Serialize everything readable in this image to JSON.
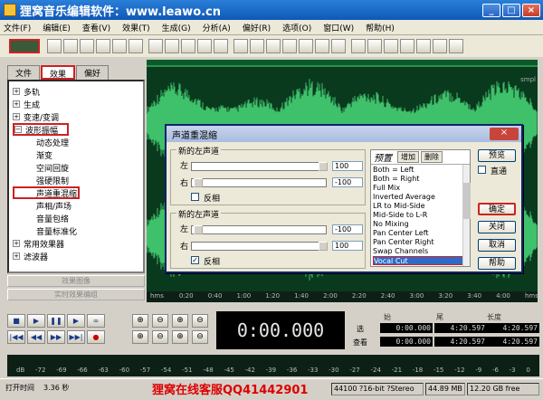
{
  "window": {
    "title": "狸窝音乐编辑软件：www.leawo.cn",
    "buttons": [
      "_",
      "□",
      "×"
    ]
  },
  "menu": [
    "文件(F)",
    "编辑(E)",
    "查看(V)",
    "效果(T)",
    "生成(G)",
    "分析(A)",
    "偏好(R)",
    "选项(O)",
    "窗口(W)",
    "帮助(H)"
  ],
  "toolbar": {
    "icon_count": 25
  },
  "left_panel": {
    "tabs": [
      "文件",
      "效果",
      "偏好"
    ],
    "tree": [
      {
        "label": "多轨",
        "type": "group",
        "expanded": false
      },
      {
        "label": "生成",
        "type": "group",
        "expanded": false
      },
      {
        "label": "变速/变调",
        "type": "group",
        "expanded": false
      },
      {
        "label": "波形振幅",
        "type": "group",
        "expanded": true,
        "highlight": true
      },
      {
        "label": "动态处理",
        "type": "child"
      },
      {
        "label": "渐变",
        "type": "child"
      },
      {
        "label": "空间回旋",
        "type": "child"
      },
      {
        "label": "强硬限制",
        "type": "child"
      },
      {
        "label": "声道重混缩",
        "type": "child",
        "selected": true
      },
      {
        "label": "声相/声场",
        "type": "child"
      },
      {
        "label": "音量包络",
        "type": "child"
      },
      {
        "label": "音量标准化",
        "type": "child"
      },
      {
        "label": "常用效果器",
        "type": "group",
        "expanded": false
      },
      {
        "label": "滤波器",
        "type": "group",
        "expanded": false
      }
    ],
    "buttons": [
      "效果图像",
      "实时效果编组"
    ]
  },
  "wave": {
    "unit_top": "smpl",
    "unit_bottom": "smpl",
    "color": "#3fc06a",
    "bg": "#0a3a1e"
  },
  "timeline": [
    "hms",
    "0:20",
    "0:40",
    "1:00",
    "1:20",
    "1:40",
    "2:00",
    "2:20",
    "2:40",
    "3:00",
    "3:20",
    "3:40",
    "4:00",
    "hms"
  ],
  "dialog": {
    "title": "声道重混缩",
    "close": "×",
    "left_group": {
      "legend": "新的左声道",
      "left_label": "左",
      "right_label": "右",
      "left_value": "100",
      "right_value": "-100",
      "invert_label": "反相",
      "invert_checked": false
    },
    "right_group": {
      "legend": "新的左声道",
      "left_label": "左",
      "right_label": "右",
      "left_value": "-100",
      "right_value": "100",
      "invert_label": "反相",
      "invert_checked": true
    },
    "presets": {
      "title": "预置",
      "add": "增加",
      "delete": "删除",
      "items": [
        "Both = Left",
        "Both = Right",
        "Full Mix",
        "Inverted Average",
        "LR to Mid-Side",
        "Mid-Side to L-R",
        "No Mixing",
        "Pan Center Left",
        "Pan Center Right",
        "Swap Channels",
        "Vocal Cut"
      ],
      "selected": "Vocal Cut"
    },
    "preview": "预览",
    "bypass": "直通",
    "ok": "确定",
    "close_btn": "关闭",
    "cancel": "取消",
    "help": "帮助"
  },
  "transport": {
    "buttons": [
      "■",
      "▶",
      "❚❚",
      "▶",
      "∞",
      "|◀◀",
      "◀◀",
      "▶▶",
      "▶▶|",
      "●"
    ]
  },
  "zoom": {
    "buttons": [
      "⊕",
      "⊖",
      "⊕",
      "⊖",
      "⊕",
      "⊖",
      "⊕",
      "⊖"
    ]
  },
  "time_display": "0:00.000",
  "selection": {
    "headers": [
      "始",
      "尾",
      "长度"
    ],
    "rows": [
      {
        "label": "选",
        "values": [
          "0:00.000",
          "4:20.597",
          "4:20.597"
        ]
      },
      {
        "label": "查看",
        "values": [
          "0:00.000",
          "4:20.597",
          "4:20.597"
        ]
      }
    ]
  },
  "level_meter": [
    "dB",
    "-72",
    "-69",
    "-66",
    "-63",
    "-60",
    "-57",
    "-54",
    "-51",
    "-48",
    "-45",
    "-42",
    "-39",
    "-36",
    "-33",
    "-30",
    "-27",
    "-24",
    "-21",
    "-18",
    "-15",
    "-12",
    "-9",
    "-6",
    "-3",
    "0"
  ],
  "status": {
    "open_time": "打开时间",
    "seconds": "3.36 秒",
    "promo": "狸窝在线客服QQ41442901",
    "format": "44100 ?16-bit ?Stereo",
    "size": "44.89 MB",
    "free": "12.20 GB free"
  }
}
